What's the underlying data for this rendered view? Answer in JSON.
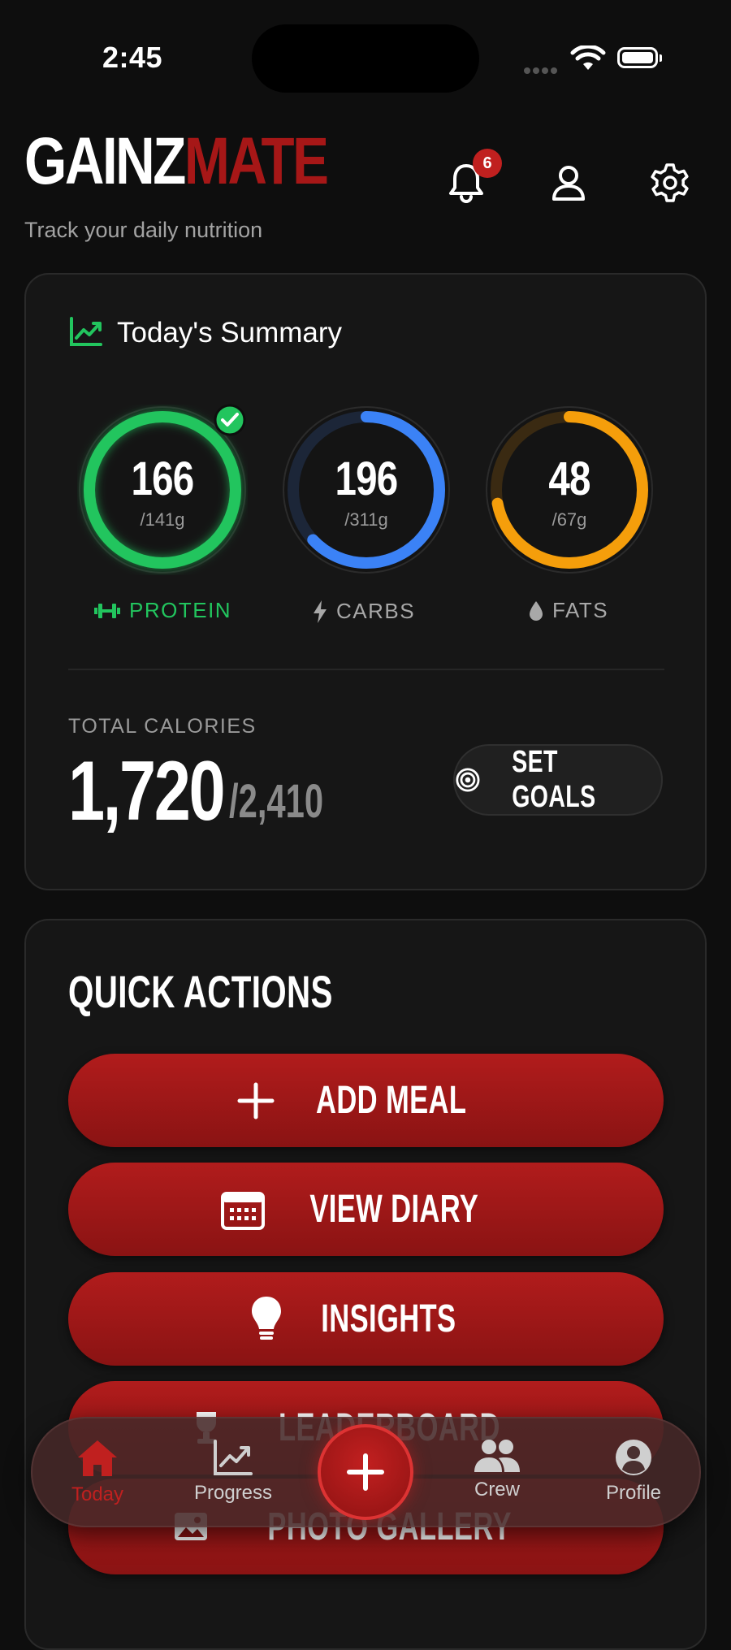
{
  "status_bar": {
    "time": "2:45"
  },
  "header": {
    "brand_part1": "GAINZ",
    "brand_part2": "MATE",
    "tagline": "Track your daily nutrition",
    "notification_count": "6",
    "icons": [
      "bell-icon",
      "user-icon",
      "gear-icon"
    ]
  },
  "summary": {
    "title": "Today's Summary",
    "macros": [
      {
        "label": "PROTEIN",
        "value": "166",
        "goal": "/141g",
        "progress": 1.0,
        "color": "#22c55e",
        "complete": true,
        "icon": "dumbbell-icon"
      },
      {
        "label": "CARBS",
        "value": "196",
        "goal": "/311g",
        "progress": 0.63,
        "color": "#3b82f6",
        "complete": false,
        "icon": "bolt-icon"
      },
      {
        "label": "FATS",
        "value": "48",
        "goal": "/67g",
        "progress": 0.72,
        "color": "#f59e0b",
        "complete": false,
        "icon": "drop-icon"
      }
    ],
    "calories_label": "TOTAL CALORIES",
    "calories_value": "1,720",
    "calories_goal": "/2,410",
    "set_goals_label": "SET GOALS"
  },
  "quick_actions": {
    "title": "QUICK ACTIONS",
    "buttons": [
      {
        "label": "ADD MEAL",
        "icon": "plus-icon"
      },
      {
        "label": "VIEW DIARY",
        "icon": "calendar-icon"
      },
      {
        "label": "INSIGHTS",
        "icon": "lightbulb-icon"
      },
      {
        "label": "LEADERBOARD",
        "icon": "trophy-icon"
      },
      {
        "label": "PHOTO GALLERY",
        "icon": "image-icon"
      }
    ]
  },
  "nav": {
    "items": [
      {
        "label": "Today",
        "icon": "home-icon",
        "active": true
      },
      {
        "label": "Progress",
        "icon": "chart-icon",
        "active": false
      },
      {
        "label": "Crew",
        "icon": "group-icon",
        "active": false
      },
      {
        "label": "Profile",
        "icon": "profile-icon",
        "active": false
      }
    ]
  },
  "colors": {
    "accent": "#a61717",
    "protein": "#22c55e",
    "carbs": "#3b82f6",
    "fats": "#f59e0b"
  }
}
